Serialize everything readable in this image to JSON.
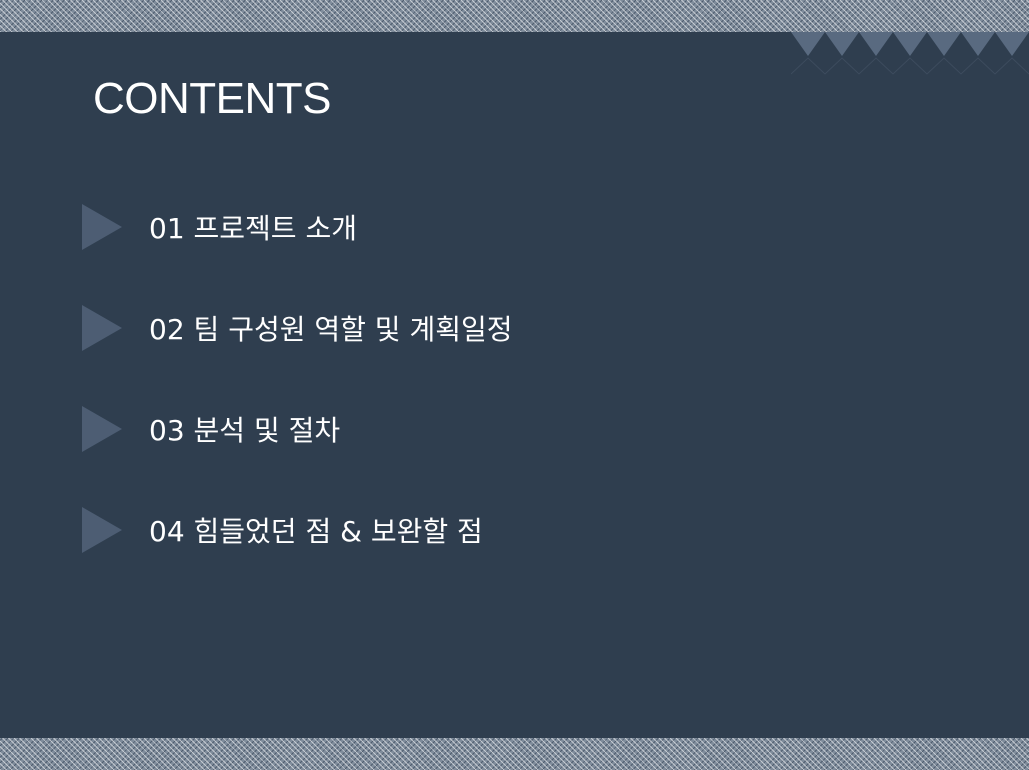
{
  "slide": {
    "title": "CONTENTS",
    "items": [
      {
        "label": "01 프로젝트 소개"
      },
      {
        "label": "02 팀 구성원 역할 및 계획일정"
      },
      {
        "label": "03 분석 및 절차"
      },
      {
        "label": "04 힘들었던 점 & 보완할 점"
      }
    ]
  },
  "colors": {
    "background": "#2f3e4f",
    "arrow": "#4d5d73",
    "band": "#7f8c9b",
    "text": "#ffffff"
  },
  "icons": {
    "bullet": "triangle-right-icon",
    "corner_decoration": "triangle-pattern-icon"
  }
}
